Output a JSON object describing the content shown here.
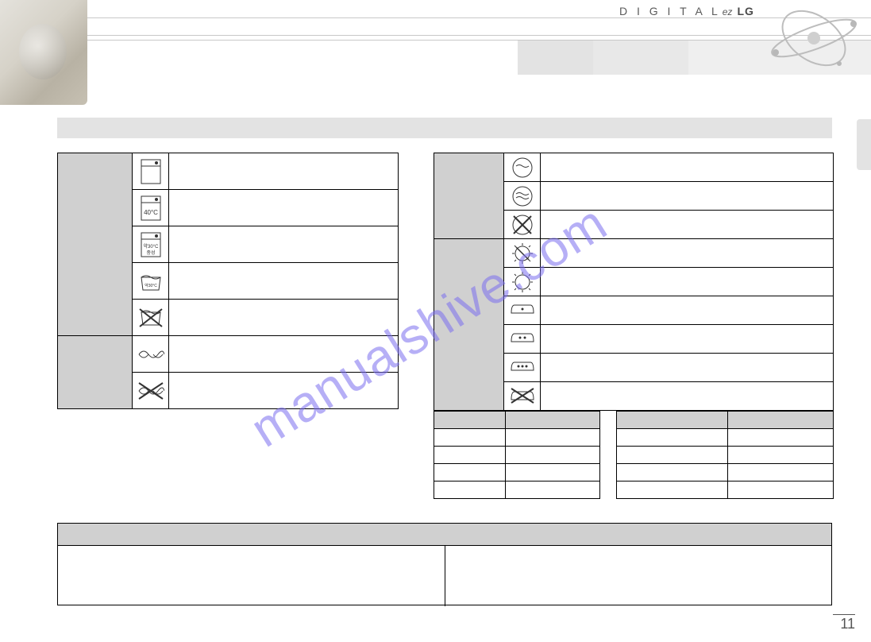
{
  "brand": {
    "digital": "D I G I T A L",
    "ez": "ez",
    "lg": "LG"
  },
  "page_number": "11",
  "watermark": "manualshive.com",
  "title_bar": "",
  "left_table": {
    "groups": [
      {
        "category": "",
        "rows": [
          {
            "symbol": "wash-95",
            "desc": ""
          },
          {
            "symbol": "wash-40",
            "desc": ""
          },
          {
            "symbol": "wash-30-neutral",
            "desc": ""
          },
          {
            "symbol": "handwash-30",
            "desc": ""
          },
          {
            "symbol": "no-wash",
            "desc": ""
          }
        ]
      },
      {
        "category": "",
        "rows": [
          {
            "symbol": "wring-ok",
            "desc": ""
          },
          {
            "symbol": "no-wring",
            "desc": ""
          }
        ]
      }
    ]
  },
  "right_table": {
    "groups": [
      {
        "category": "",
        "rows": [
          {
            "symbol": "dry-circle-a",
            "desc": ""
          },
          {
            "symbol": "dry-circle-b",
            "desc": ""
          },
          {
            "symbol": "no-tumble-dry",
            "desc": ""
          }
        ]
      },
      {
        "category": "",
        "rows": [
          {
            "symbol": "sun-shade",
            "desc": ""
          },
          {
            "symbol": "sun",
            "desc": ""
          },
          {
            "symbol": "iron-1",
            "desc": ""
          },
          {
            "symbol": "iron-2",
            "desc": ""
          },
          {
            "symbol": "iron-3",
            "desc": ""
          },
          {
            "symbol": "no-iron",
            "desc": ""
          }
        ]
      }
    ]
  },
  "grid_a": {
    "header": [
      "",
      ""
    ],
    "rows": [
      [
        "",
        ""
      ],
      [
        "",
        ""
      ],
      [
        "",
        ""
      ],
      [
        "",
        ""
      ]
    ]
  },
  "grid_b": {
    "header": [
      "",
      ""
    ],
    "rows": [
      [
        "",
        ""
      ],
      [
        "",
        ""
      ],
      [
        "",
        ""
      ],
      [
        "",
        ""
      ]
    ]
  },
  "notes": {
    "header": "",
    "left": "",
    "right": ""
  }
}
